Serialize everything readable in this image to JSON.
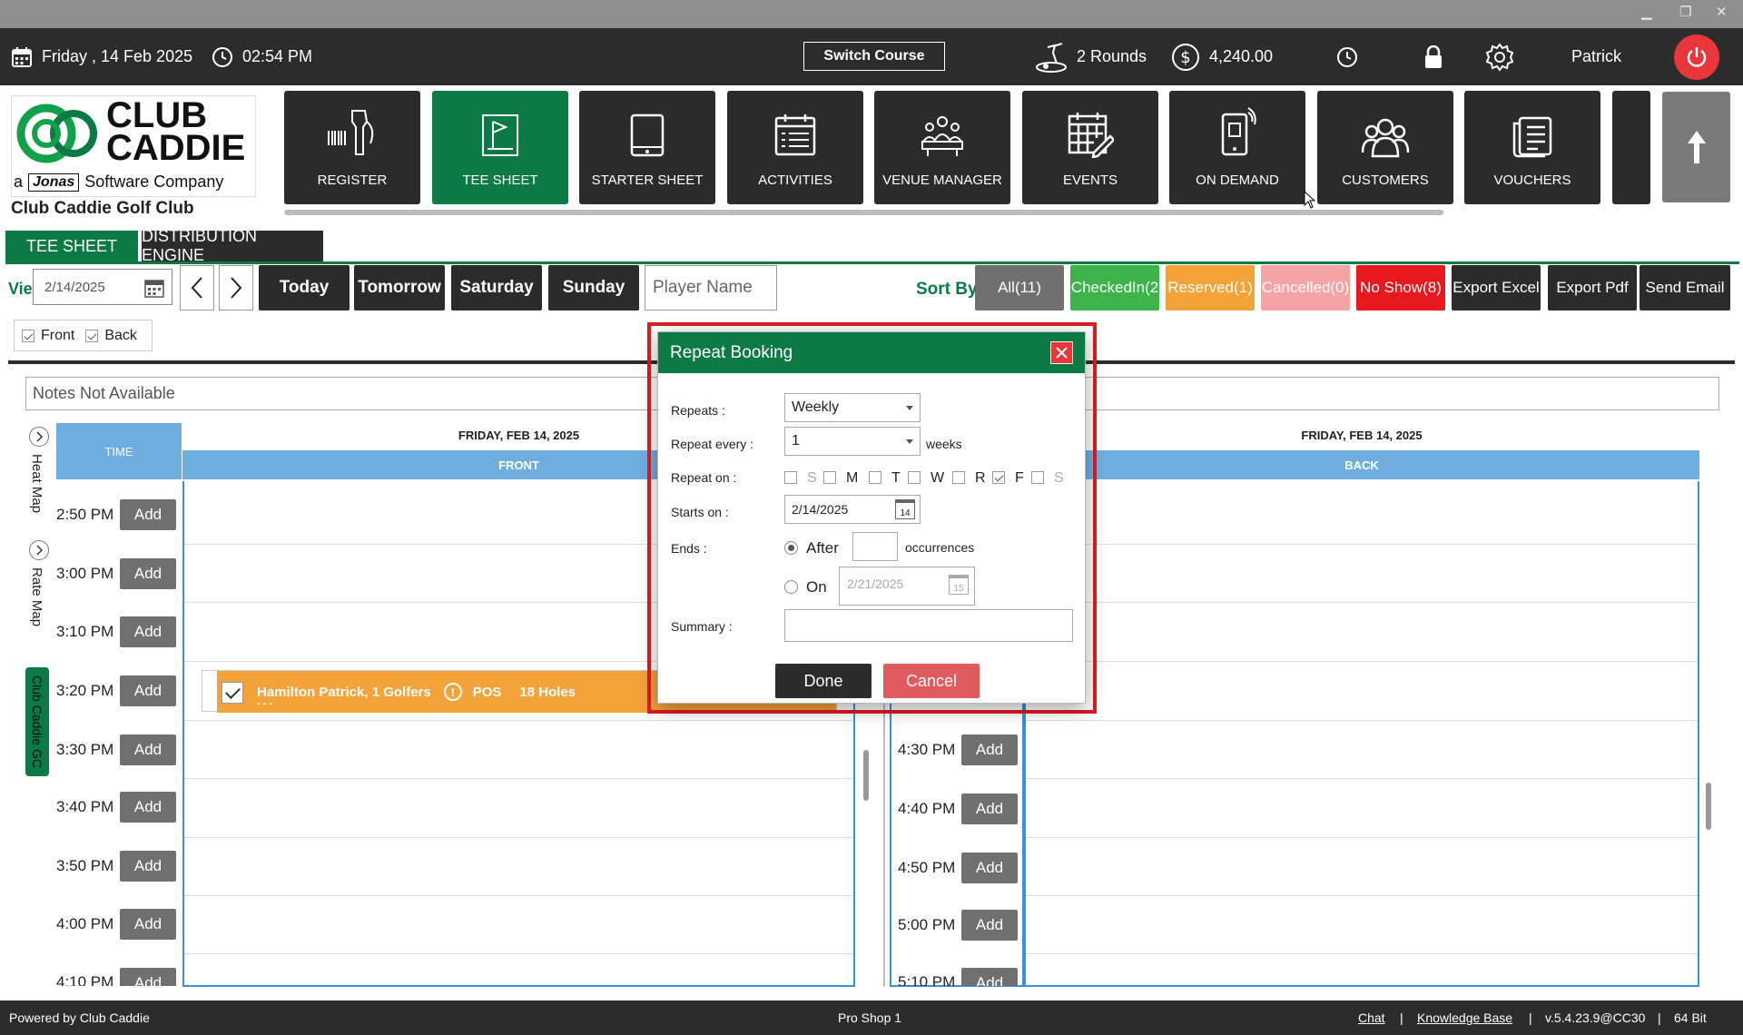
{
  "window": {
    "min": "▁",
    "restore": "❐",
    "close": "✕"
  },
  "topbar": {
    "date": "Friday ,  14 Feb 2025",
    "time": "02:54 PM",
    "switch_course": "Switch Course",
    "rounds": "2 Rounds",
    "balance": "4,240.00",
    "user": "Patrick"
  },
  "logo": {
    "line1": "CLUB",
    "line2": "CADDIE",
    "tagline_a": "a",
    "tagline_brand": "Jonas",
    "tagline_rest": "Software Company",
    "club_name": "Club Caddie Golf Club"
  },
  "nav": [
    {
      "label": "REGISTER"
    },
    {
      "label": "TEE SHEET"
    },
    {
      "label": "STARTER SHEET"
    },
    {
      "label": "ACTIVITIES"
    },
    {
      "label": "VENUE MANAGER"
    },
    {
      "label": "EVENTS"
    },
    {
      "label": "ON DEMAND"
    },
    {
      "label": "CUSTOMERS"
    },
    {
      "label": "VOUCHERS"
    }
  ],
  "tabs": [
    {
      "label": "TEE SHEET"
    },
    {
      "label": "DISTRIBUTION ENGINE"
    }
  ],
  "toolbar": {
    "view_prefix": "Vie",
    "date_value": "2/14/2025",
    "today": "Today",
    "tomorrow": "Tomorrow",
    "saturday": "Saturday",
    "sunday": "Sunday",
    "player_placeholder": "Player Name",
    "sort_by": "Sort By",
    "all": "All(11)",
    "checked_in": "CheckedIn(2",
    "reserved": "Reserved(1)",
    "cancelled": "Cancelled(0)",
    "no_show": "No Show(8)",
    "export_excel": "Export Excel",
    "export_pdf": "Export Pdf",
    "send_email": "Send Email",
    "front": "Front",
    "back": "Back"
  },
  "notes": "Notes Not Available",
  "side": {
    "heat_map": "Heat Map",
    "rate_map": "Rate Map",
    "club": "Club Caddie GC"
  },
  "grid": {
    "time_header": "TIME",
    "front_date": "FRIDAY, FEB 14, 2025",
    "front_label": "FRONT",
    "back_date": "FRIDAY, FEB 14, 2025",
    "back_label": "BACK",
    "add": "Add",
    "left_times": [
      "2:50 PM",
      "3:00 PM",
      "3:10 PM",
      "3:20 PM",
      "3:30 PM",
      "3:40 PM",
      "3:50 PM",
      "4:00 PM",
      "4:10 PM"
    ],
    "right_times": [
      "4:30 PM",
      "4:40 PM",
      "4:50 PM",
      "5:00 PM",
      "5:10 PM"
    ]
  },
  "booking": {
    "name": "Hamilton Patrick, 1 Golfers",
    "pos": "POS",
    "holes": "18 Holes",
    "sub": "- - -"
  },
  "modal": {
    "title": "Repeat Booking",
    "repeats_label": "Repeats :",
    "repeats_value": "Weekly",
    "every_label": "Repeat every :",
    "every_value": "1",
    "every_unit": "weeks",
    "on_label": "Repeat on :",
    "days": [
      {
        "label": "S",
        "checked": false,
        "disabled": true
      },
      {
        "label": "M",
        "checked": false,
        "disabled": false
      },
      {
        "label": "T",
        "checked": false,
        "disabled": false
      },
      {
        "label": "W",
        "checked": false,
        "disabled": false
      },
      {
        "label": "R",
        "checked": false,
        "disabled": false
      },
      {
        "label": "F",
        "checked": true,
        "disabled": false
      },
      {
        "label": "S",
        "checked": false,
        "disabled": true
      }
    ],
    "starts_label": "Starts on :",
    "starts_value": "2/14/2025",
    "cal_day_1": "14",
    "ends_label": "Ends :",
    "after_label": "After",
    "occurrences": "occurrences",
    "on_radio_label": "On",
    "end_date": "2/21/2025",
    "cal_day_2": "15",
    "summary_label": "Summary :",
    "done": "Done",
    "cancel": "Cancel"
  },
  "status": {
    "powered": "Powered by Club Caddie",
    "shop": "Pro Shop 1",
    "chat": "Chat",
    "kb": "Knowledge Base",
    "version": "v.5.4.23.9@CC30",
    "bits": "64 Bit",
    "sep": "|"
  },
  "colors": {
    "green": "#0b7a45",
    "dark": "#2b2b2b",
    "blue": "#70aee0",
    "red": "#e8363a",
    "orange": "#f4a23a"
  }
}
